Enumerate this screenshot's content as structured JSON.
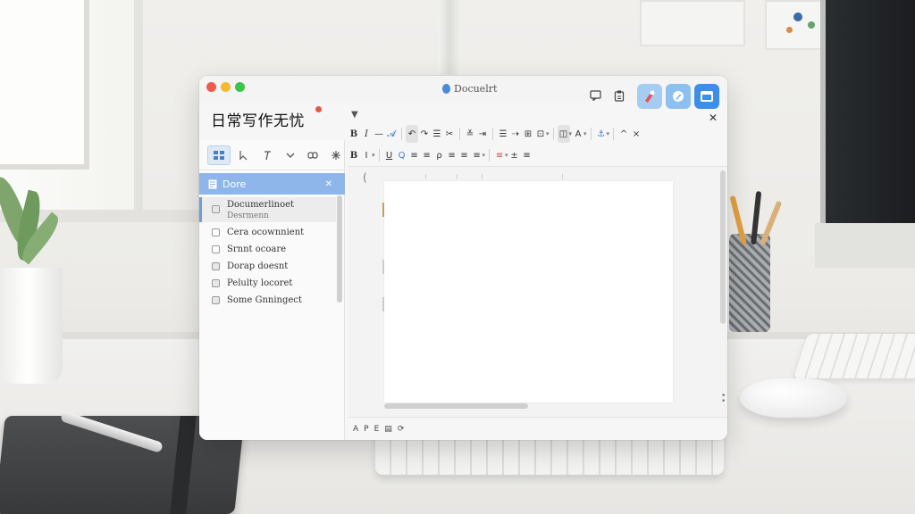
{
  "window": {
    "title": "Docuelrt",
    "app_name": "日常写作无忧"
  },
  "header_icons": [
    "chat-icon",
    "clipboard-icon",
    "highlighter-icon",
    "pen-icon",
    "window-icon"
  ],
  "sidebar": {
    "tools": [
      "grid-view-icon",
      "cursor-icon",
      "italic-t-icon",
      "chevron-down-icon",
      "link-icon",
      "sparkle-icon"
    ],
    "selected": {
      "label": "Dore",
      "icon": "document-icon"
    },
    "items": [
      {
        "label": "Documerlinoet",
        "sublabel": "Desrmenn",
        "checked": true
      },
      {
        "label": "Cera ocownnient",
        "checked": false
      },
      {
        "label": "Srnnt ocoare",
        "checked": false
      },
      {
        "label": "Dorap doesnt",
        "checked": true
      },
      {
        "label": "Pelulty locoret",
        "checked": true
      },
      {
        "label": "Some Gnningect",
        "checked": true
      }
    ]
  },
  "toolbar1": {
    "buttons": [
      "B",
      "I",
      "—",
      "𝓐",
      "↶",
      "↷",
      "☰",
      "✂",
      "≚",
      "⇥",
      "☰",
      "⇢",
      "⊞",
      "⊡",
      "◫",
      "A",
      "⚓"
    ],
    "nav": [
      "^",
      "×"
    ]
  },
  "toolbar2": {
    "buttons": [
      "B",
      "I",
      "U",
      "Q",
      "≡",
      "≡",
      "ρ",
      "≡",
      "≡",
      "≡",
      "≡",
      "±",
      "≡"
    ]
  },
  "statusbar": {
    "buttons": [
      "A",
      "P",
      "E",
      "▤",
      "⟳"
    ]
  },
  "colors": {
    "accent": "#3c8ee8",
    "selected_row": "#8fb6ea",
    "red_badge": "#e45848"
  }
}
